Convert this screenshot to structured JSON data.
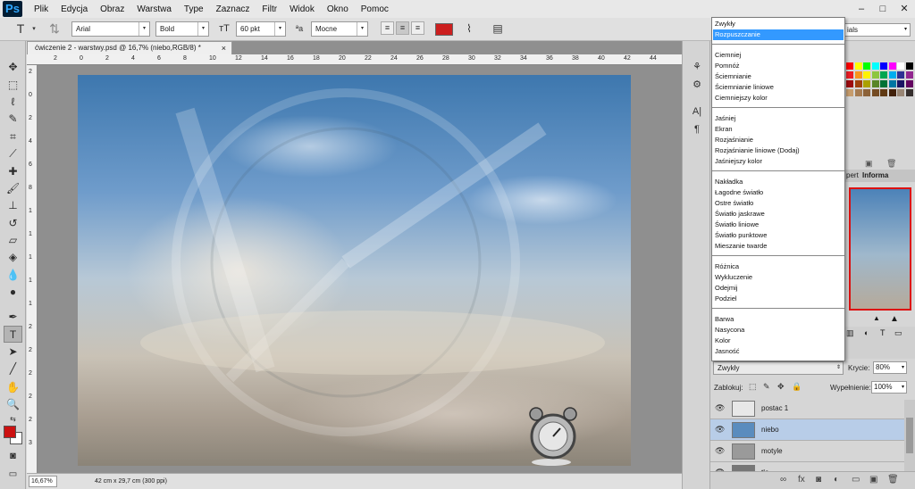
{
  "app": {
    "logo": "Ps"
  },
  "menu": [
    "Plik",
    "Edycja",
    "Obraz",
    "Warstwa",
    "Type",
    "Zaznacz",
    "Filtr",
    "Widok",
    "Okno",
    "Pomoc"
  ],
  "window_controls": {
    "minimize": "–",
    "maximize": "□",
    "close": "✕"
  },
  "options_bar": {
    "tool_icon": "text-tool-icon",
    "font_family": "Arial",
    "font_style": "Bold",
    "font_size": "60 pkt",
    "antialias": "Mocne",
    "text_color": "#cc1f1f"
  },
  "workspace": {
    "label": "ials"
  },
  "document": {
    "tab_title": "ćwiczenie 2 - warstwy.psd @ 16,7% (niebo,RGB/8) *",
    "zoom": "16,67%",
    "doc_info": "42 cm x 29,7 cm (300 ppi)"
  },
  "ruler_h": [
    "2",
    "0",
    "2",
    "4",
    "6",
    "8",
    "10",
    "12",
    "14",
    "16",
    "18",
    "20",
    "22",
    "24",
    "26",
    "28",
    "30",
    "32",
    "34",
    "36",
    "38",
    "40",
    "42",
    "44"
  ],
  "ruler_v": [
    "2",
    "0",
    "2",
    "4",
    "6",
    "8",
    "1",
    "1",
    "1",
    "1",
    "1",
    "2",
    "2",
    "2",
    "2",
    "2",
    "3"
  ],
  "colors": {
    "foreground": "#cc1111",
    "background": "#ffffff"
  },
  "blend_dropdown": {
    "groups": [
      [
        "Zwykły",
        "Rozpuszczanie"
      ],
      [
        "Ciemniej",
        "Pomnóż",
        "Ściemnianie",
        "Ściemnianie liniowe",
        "Ciemniejszy kolor"
      ],
      [
        "Jaśniej",
        "Ekran",
        "Rozjaśnianie",
        "Rozjaśnianie liniowe (Dodaj)",
        "Jaśniejszy kolor"
      ],
      [
        "Nakładka",
        "Łagodne światło",
        "Ostre światło",
        "Światło jaskrawe",
        "Światło liniowe",
        "Światło punktowe",
        "Mieszanie twarde"
      ],
      [
        "Różnica",
        "Wykluczenie",
        "Odejmij",
        "Podziel"
      ],
      [
        "Barwa",
        "Nasycona",
        "Kolor",
        "Jasność"
      ]
    ],
    "selected": "Rozpuszczanie"
  },
  "panels": {
    "nav_tabs": [
      "pert",
      "Informa"
    ],
    "layers": {
      "blend_mode": "Zwykły",
      "opacity_label": "Krycie:",
      "opacity": "80%",
      "lock_label": "Zablokuj:",
      "fill_label": "Wypełnienie:",
      "fill": "100%",
      "items": [
        {
          "name": "postac 1",
          "selected": false,
          "thumb": "#e8e8e8"
        },
        {
          "name": "niebo",
          "selected": true,
          "thumb": "#5a8cbe"
        },
        {
          "name": "motyle",
          "selected": false,
          "thumb": "#9a9a9a"
        },
        {
          "name": "tło",
          "selected": false,
          "thumb": "#777777"
        }
      ]
    }
  }
}
